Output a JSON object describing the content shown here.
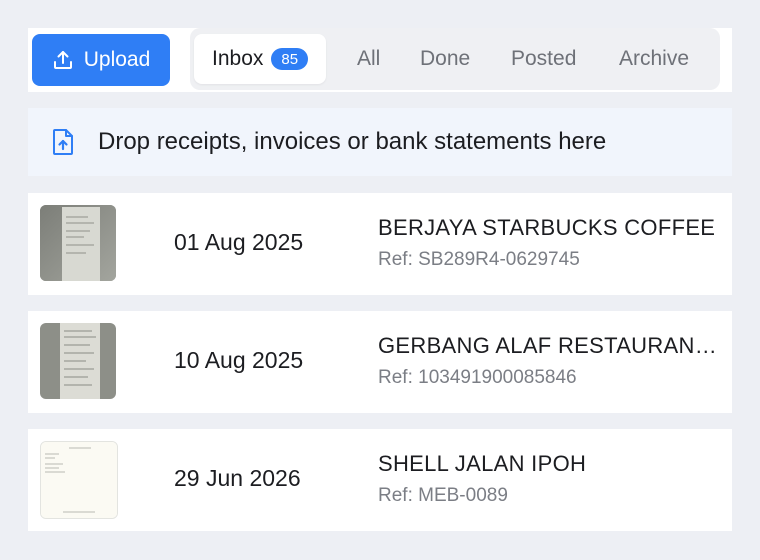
{
  "toolbar": {
    "upload_label": "Upload",
    "tabs": [
      {
        "label": "Inbox",
        "badge": "85",
        "active": true
      },
      {
        "label": "All"
      },
      {
        "label": "Done"
      },
      {
        "label": "Posted"
      },
      {
        "label": "Archive"
      }
    ]
  },
  "dropzone": {
    "text": "Drop receipts, invoices or bank statements here",
    "icon": "file-upload-icon"
  },
  "rows": [
    {
      "date": "01 Aug 2025",
      "merchant": "BERJAYA STARBUCKS COFFEE",
      "ref": "Ref: SB289R4-0629745",
      "thumb": "receipt-photo"
    },
    {
      "date": "10 Aug 2025",
      "merchant": "GERBANG ALAF RESTAURANTS",
      "ref": "Ref: 103491900085846",
      "thumb": "receipt-photo"
    },
    {
      "date": "29 Jun 2026",
      "merchant": "SHELL JALAN IPOH",
      "ref": "Ref: MEB-0089",
      "thumb": "document-preview"
    }
  ],
  "colors": {
    "accent": "#2f7ef5",
    "background": "#edeff4"
  }
}
